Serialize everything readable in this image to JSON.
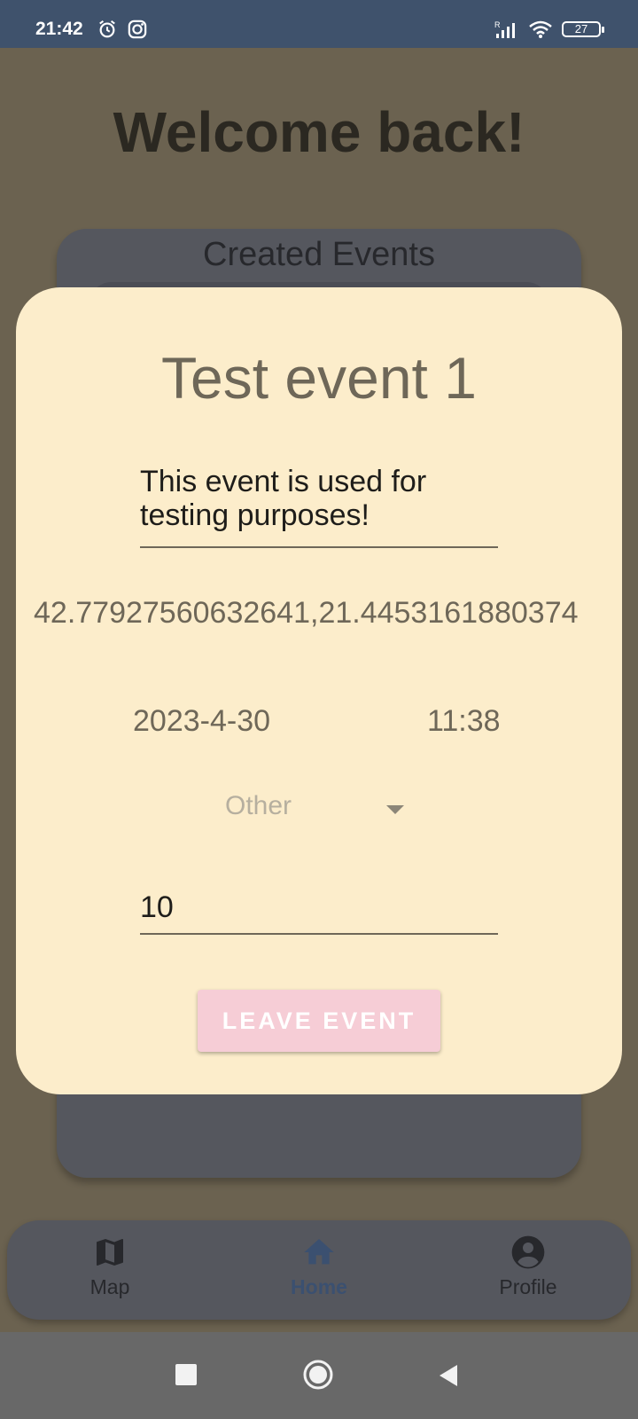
{
  "status_bar": {
    "time": "21:42",
    "battery": "27",
    "icons": [
      "alarm-icon",
      "instagram-icon",
      "signal-icon",
      "wifi-icon",
      "battery-icon"
    ]
  },
  "screen": {
    "welcome": "Welcome back!",
    "events_card_title": "Created Events"
  },
  "dialog": {
    "title": "Test event 1",
    "description": "This event is used for testing purposes!",
    "coordinates": "42.77927560632641,21.4453161880374",
    "date": "2023-4-30",
    "time": "11:38",
    "category": "Other",
    "number": "10",
    "leave_button": "LEAVE EVENT"
  },
  "bottom_nav": {
    "items": [
      {
        "label": "Map",
        "icon": "map-icon",
        "active": false
      },
      {
        "label": "Home",
        "icon": "home-icon",
        "active": true
      },
      {
        "label": "Profile",
        "icon": "account-circle-icon",
        "active": false
      }
    ]
  },
  "colors": {
    "status_bar": "#3f526c",
    "scrim_background": "#6b6250",
    "dialog_background": "#fcedcb",
    "button_background": "#f6cdd6",
    "nav_active": "#3b5070"
  }
}
